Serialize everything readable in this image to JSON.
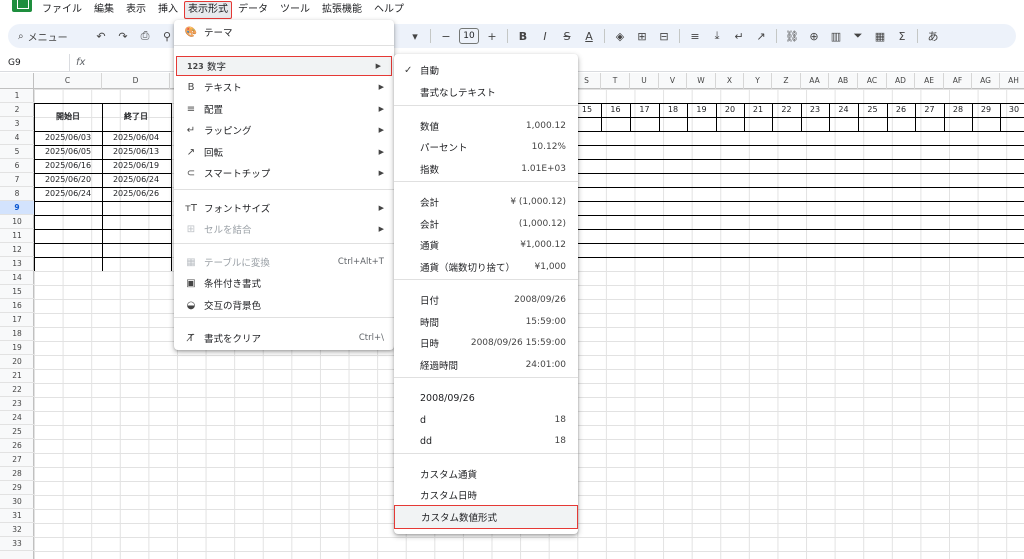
{
  "menubar": [
    "ファイル",
    "編集",
    "表示",
    "挿入",
    "表示形式",
    "データ",
    "ツール",
    "拡張機能",
    "ヘルプ"
  ],
  "toolbar": {
    "search_label": "メニュー",
    "font_size": "10",
    "input_mode": "あ"
  },
  "namebox": "G9",
  "fx": "fx",
  "columns": [
    "C",
    "D",
    "S",
    "T",
    "U",
    "V",
    "W",
    "X",
    "Y",
    "Z",
    "AA",
    "AB",
    "AC",
    "AD",
    "AE",
    "AF",
    "AG",
    "AH"
  ],
  "rows": [
    "1",
    "2",
    "3",
    "4",
    "5",
    "6",
    "7",
    "8",
    "9",
    "10",
    "11",
    "12",
    "13",
    "14",
    "15",
    "16",
    "17",
    "18",
    "19",
    "20",
    "21",
    "22",
    "23",
    "24",
    "25",
    "26",
    "27",
    "28",
    "29",
    "30",
    "31",
    "32",
    "33"
  ],
  "selected_row": "9",
  "table": {
    "header_start": "開始日",
    "header_end": "終了日",
    "start_dates": [
      "2025/06/03",
      "2025/06/05",
      "2025/06/16",
      "2025/06/20",
      "2025/06/24"
    ],
    "end_dates": [
      "2025/06/04",
      "2025/06/13",
      "2025/06/19",
      "2025/06/24",
      "2025/06/26"
    ]
  },
  "day_numbers": [
    "15",
    "16",
    "17",
    "18",
    "19",
    "20",
    "21",
    "22",
    "23",
    "24",
    "25",
    "26",
    "27",
    "28",
    "29",
    "30"
  ],
  "format_menu": {
    "items": [
      {
        "label": "テーマ",
        "icon": "palette-icon",
        "glyph": "🎨",
        "arrow": false
      },
      {
        "label": "数字",
        "icon": "number-icon",
        "glyph": "123",
        "arrow": true,
        "highlight": true
      },
      {
        "label": "テキスト",
        "icon": "bold-icon",
        "glyph": "B",
        "arrow": true
      },
      {
        "label": "配置",
        "icon": "align-icon",
        "glyph": "≡",
        "arrow": true
      },
      {
        "label": "ラッピング",
        "icon": "wrap-icon",
        "glyph": "↵",
        "arrow": true
      },
      {
        "label": "回転",
        "icon": "rotate-icon",
        "glyph": "↗",
        "arrow": true
      },
      {
        "label": "スマートチップ",
        "icon": "chip-icon",
        "glyph": "⊂",
        "arrow": true
      },
      {
        "label": "フォントサイズ",
        "icon": "font-size-icon",
        "glyph": "тT",
        "arrow": true
      },
      {
        "label": "セルを結合",
        "icon": "merge-icon",
        "glyph": "⊞",
        "arrow": true,
        "disabled": true
      },
      {
        "label": "テーブルに変換",
        "icon": "table-icon",
        "glyph": "▦",
        "shortcut": "Ctrl+Alt+T",
        "disabled": true
      },
      {
        "label": "条件付き書式",
        "icon": "paint-icon",
        "glyph": "▣",
        "arrow": false
      },
      {
        "label": "交互の背景色",
        "icon": "fill-drop-icon",
        "glyph": "◒",
        "arrow": false
      },
      {
        "label": "書式をクリア",
        "icon": "clear-format-icon",
        "glyph": "T̸",
        "shortcut": "Ctrl+\\"
      }
    ]
  },
  "number_submenu": {
    "items": [
      {
        "label": "自動",
        "value": "",
        "checked": true
      },
      {
        "label": "書式なしテキスト",
        "value": ""
      },
      {
        "label": "数値",
        "value": "1,000.12"
      },
      {
        "label": "パーセント",
        "value": "10.12%"
      },
      {
        "label": "指数",
        "value": "1.01E+03"
      },
      {
        "label": "会計",
        "value": "¥ (1,000.12)"
      },
      {
        "label": "会計",
        "value": "(1,000.12)"
      },
      {
        "label": "通貨",
        "value": "¥1,000.12"
      },
      {
        "label": "通貨（端数切り捨て）",
        "value": "¥1,000"
      },
      {
        "label": "日付",
        "value": "2008/09/26"
      },
      {
        "label": "時間",
        "value": "15:59:00"
      },
      {
        "label": "日時",
        "value": "2008/09/26 15:59:00"
      },
      {
        "label": "経過時間",
        "value": "24:01:00"
      },
      {
        "label": "2008/09/26",
        "value": ""
      },
      {
        "label": "d",
        "value": "18"
      },
      {
        "label": "dd",
        "value": "18"
      },
      {
        "label": "カスタム通貨",
        "value": ""
      },
      {
        "label": "カスタム日時",
        "value": ""
      },
      {
        "label": "カスタム数値形式",
        "value": "",
        "highlight": true
      }
    ]
  }
}
